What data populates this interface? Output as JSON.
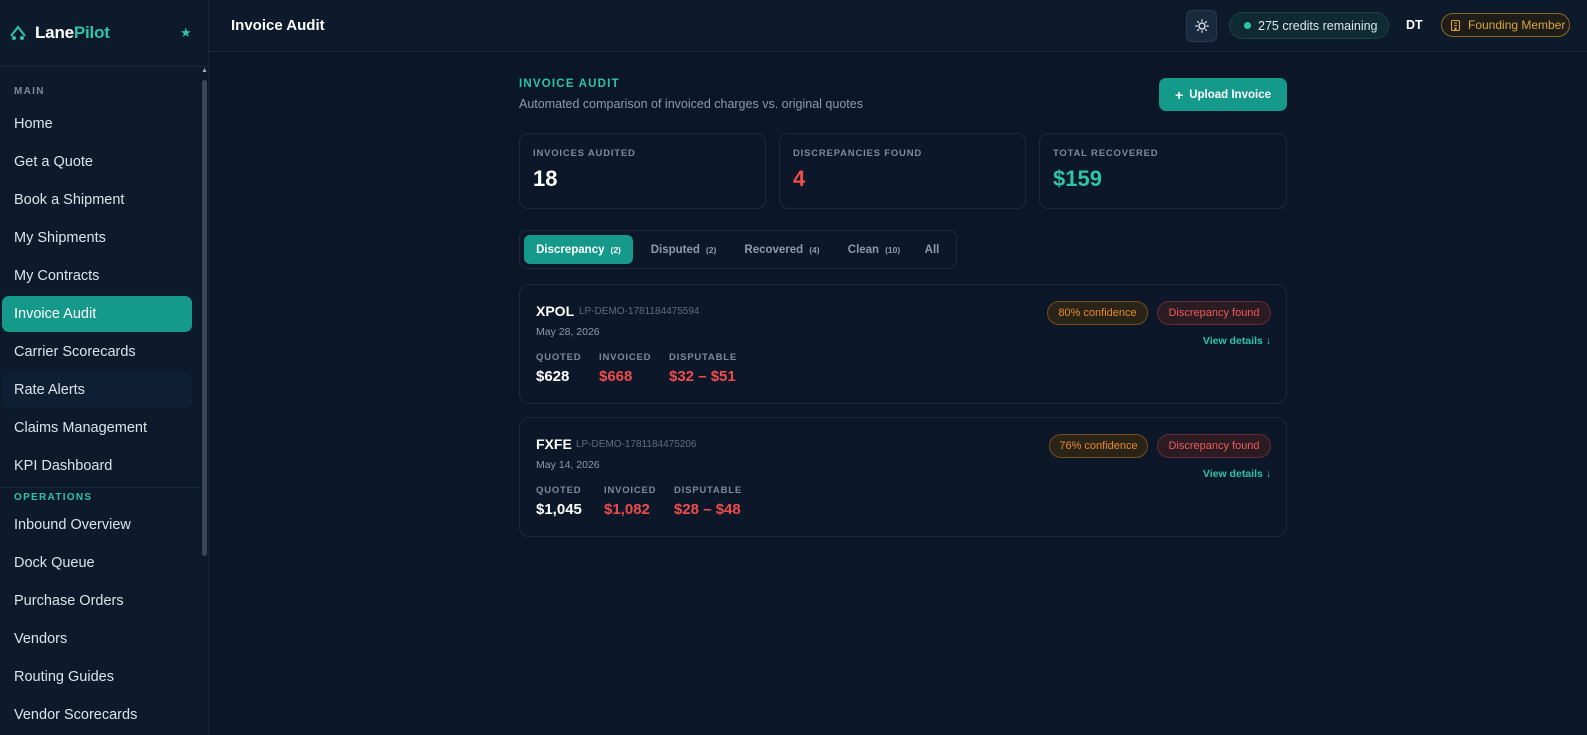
{
  "brand": {
    "name_part1": "Lane",
    "name_part2": "Pilot"
  },
  "sidebar": {
    "sections": [
      {
        "label": "MAIN",
        "color": "#7d8a9b"
      },
      {
        "label": "OPERATIONS",
        "color": "#2ec4a6"
      }
    ],
    "main_items": [
      {
        "label": "Home"
      },
      {
        "label": "Get a Quote"
      },
      {
        "label": "Book a Shipment"
      },
      {
        "label": "My Shipments"
      },
      {
        "label": "My Contracts"
      },
      {
        "label": "Invoice Audit",
        "active": true
      },
      {
        "label": "Carrier Scorecards"
      },
      {
        "label": "Rate Alerts"
      },
      {
        "label": "Claims Management"
      },
      {
        "label": "KPI Dashboard"
      }
    ],
    "ops_items": [
      {
        "label": "Inbound Overview"
      },
      {
        "label": "Dock Queue"
      },
      {
        "label": "Purchase Orders"
      },
      {
        "label": "Vendors"
      },
      {
        "label": "Routing Guides"
      },
      {
        "label": "Vendor Scorecards"
      }
    ]
  },
  "header": {
    "title": "Invoice Audit",
    "theme_icon": "sun-icon",
    "credits": "275 credits remaining",
    "avatar": "DT",
    "membership": "Founding Member"
  },
  "main": {
    "section_label": "INVOICE AUDIT",
    "section_subtitle": "Automated comparison of invoiced charges vs. original quotes",
    "upload_button": "Upload Invoice",
    "stats": [
      {
        "label": "INVOICES AUDITED",
        "value": "18",
        "color": "#ffffff"
      },
      {
        "label": "DISCREPANCIES FOUND",
        "value": "4",
        "color": "#ef4c4c"
      },
      {
        "label": "TOTAL RECOVERED",
        "value": "$159",
        "color": "#2ec4a6"
      }
    ],
    "tabs": [
      {
        "label": "Discrepancy",
        "count": "(2)",
        "active": true
      },
      {
        "label": "Disputed",
        "count": "(2)"
      },
      {
        "label": "Recovered",
        "count": "(4)"
      },
      {
        "label": "Clean",
        "count": "(10)"
      },
      {
        "label": "All",
        "count": ""
      }
    ],
    "column_labels": {
      "quoted": "QUOTED",
      "invoiced": "INVOICED",
      "disputable": "DISPUTABLE"
    },
    "view_details": "View details ↓",
    "invoices": [
      {
        "carrier": "XPOL",
        "ref": "LP-DEMO-1781184475594",
        "date": "May 28, 2026",
        "quoted": "$628",
        "invoiced": "$668",
        "disputable": "$32 – $51",
        "confidence": "80% confidence",
        "status": "Discrepancy found"
      },
      {
        "carrier": "FXFE",
        "ref": "LP-DEMO-1781184475206",
        "date": "May 14, 2026",
        "quoted": "$1,045",
        "invoiced": "$1,082",
        "disputable": "$28 – $48",
        "confidence": "76% confidence",
        "status": "Discrepancy found"
      }
    ]
  }
}
